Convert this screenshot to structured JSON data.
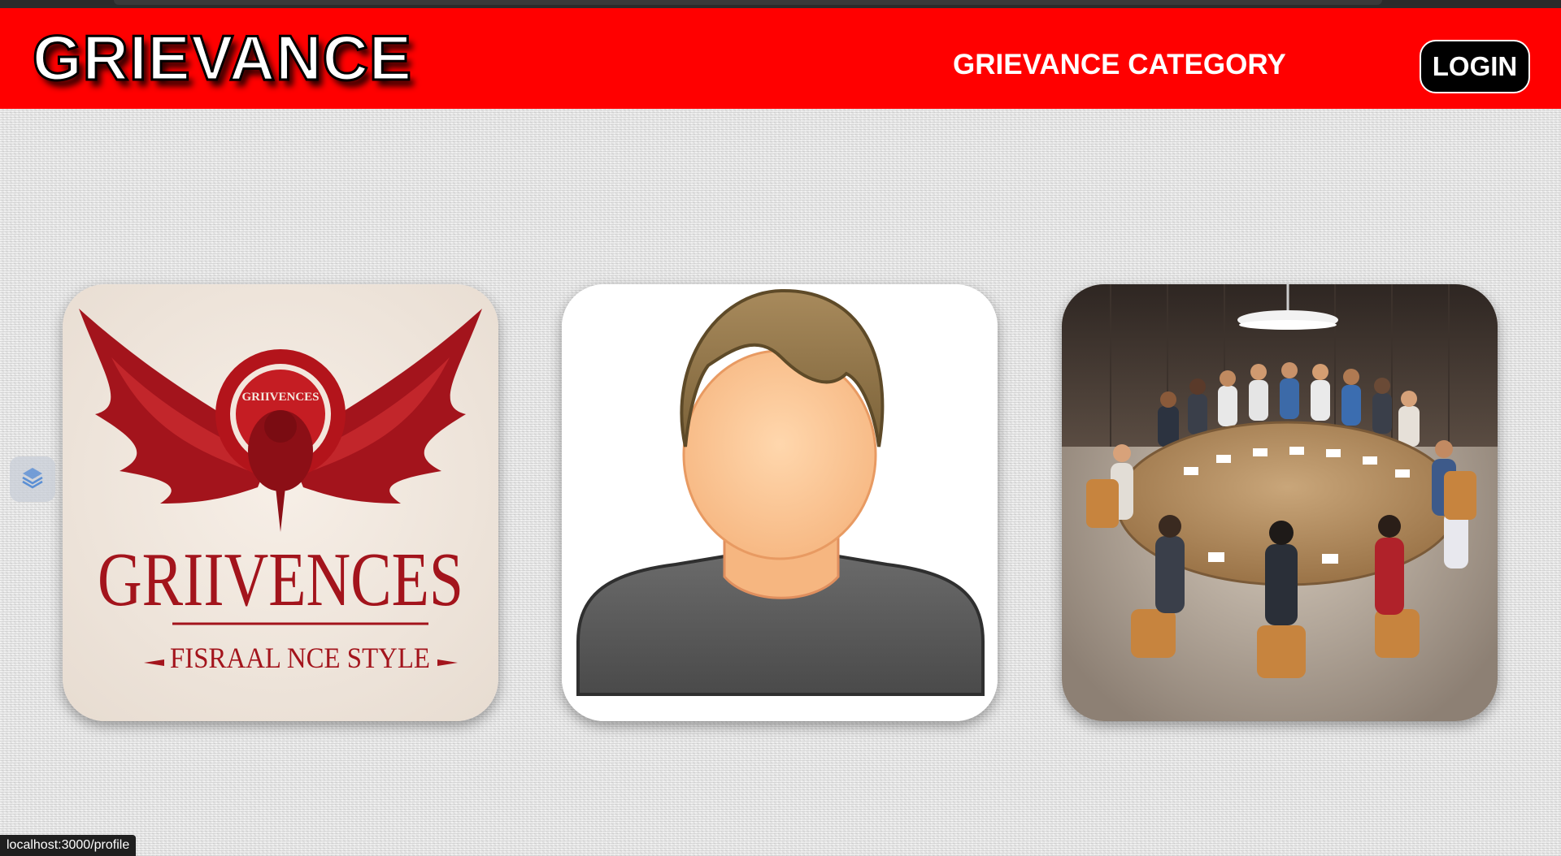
{
  "header": {
    "brand": "GRIEVANCE",
    "nav_category": "GRIEVANCE CATEGORY",
    "login_label": "LOGIN",
    "background_color": "#ff0000"
  },
  "cards": [
    {
      "name": "logo-card",
      "logo_title": "GRIIVENCES",
      "logo_subtitle": "FISRAAL NCE STYLE",
      "seal_text": "GRIIVENCES"
    },
    {
      "name": "profile-card",
      "icon": "user-avatar-icon"
    },
    {
      "name": "meeting-card",
      "icon": "round-table-meeting-image"
    }
  ],
  "side_widget": {
    "icon": "layers-icon"
  },
  "status_bar": {
    "url": "localhost:3000/profile"
  }
}
